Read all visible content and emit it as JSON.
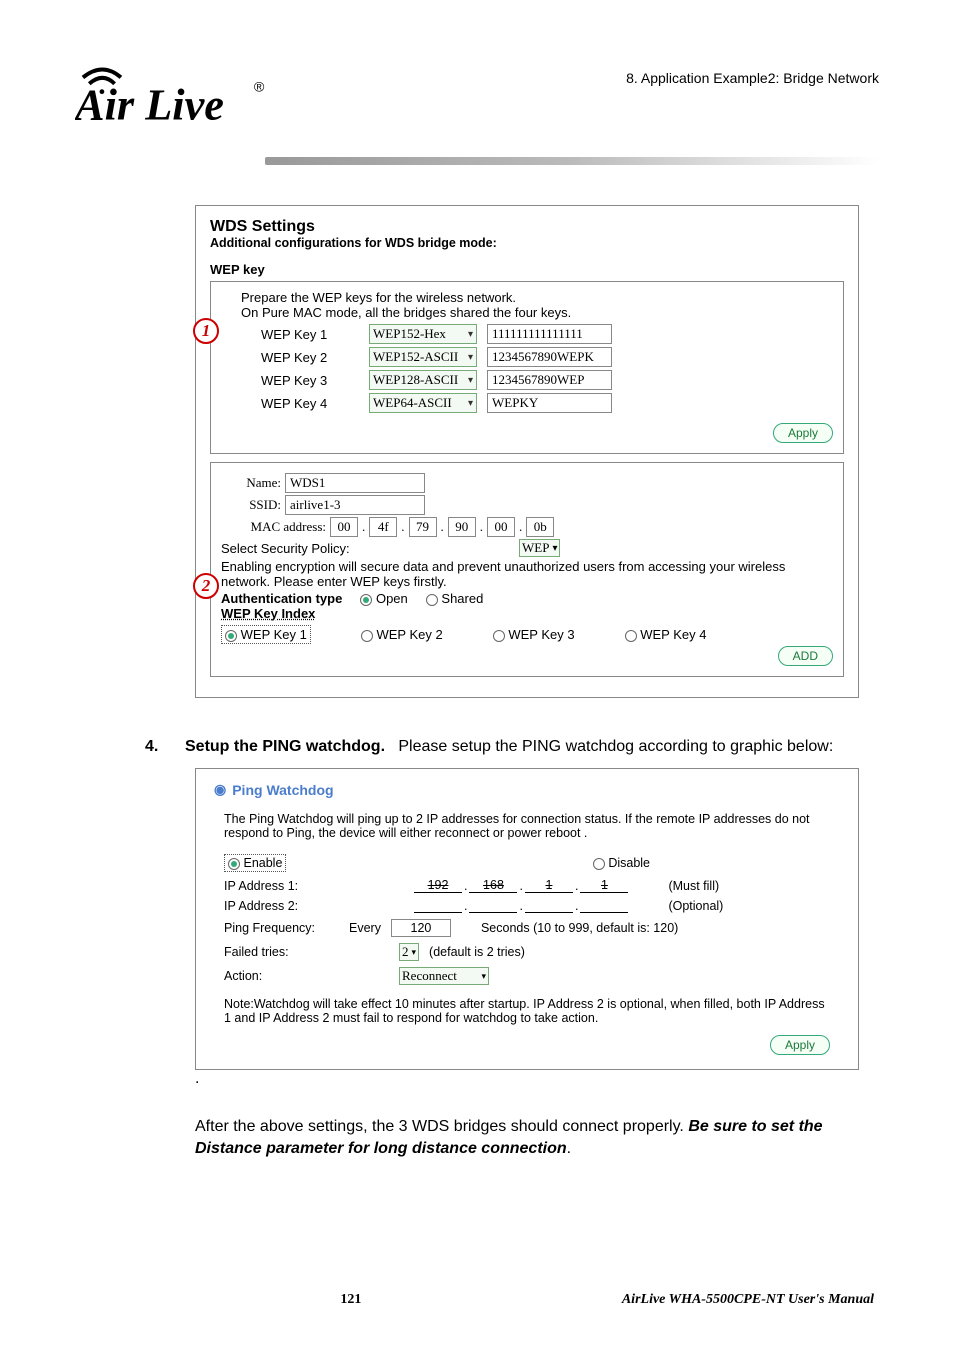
{
  "chapter": "8.  Application  Example2:  Bridge  Network",
  "wds": {
    "title": "WDS Settings",
    "subtitle": "Additional configurations for WDS bridge mode:",
    "wep_heading": "WEP key",
    "intro1": "Prepare the WEP keys for the wireless network.",
    "intro2": "On Pure MAC mode, all the bridges shared the four keys.",
    "keys": [
      {
        "label": "WEP Key 1",
        "type": "WEP152-Hex",
        "value": "111111111111111"
      },
      {
        "label": "WEP Key 2",
        "type": "WEP152-ASCII",
        "value": "1234567890WEPK"
      },
      {
        "label": "WEP Key 3",
        "type": "WEP128-ASCII",
        "value": "1234567890WEP"
      },
      {
        "label": "WEP Key 4",
        "type": "WEP64-ASCII",
        "value": "WEPKY"
      }
    ],
    "apply": "Apply",
    "name_label": "Name:",
    "name_value": "WDS1",
    "ssid_label": "SSID:",
    "ssid_value": "airlive1-3",
    "mac_label": "MAC address:",
    "mac": [
      "00",
      "4f",
      "79",
      "90",
      "00",
      "0b"
    ],
    "security_label": "Select Security Policy:",
    "security_value": "WEP",
    "enc_note": "Enabling encryption will secure data and prevent unauthorized users from accessing your wireless network. Please enter WEP keys firstly.",
    "auth_label": "Authentication type",
    "auth_open": "Open",
    "auth_shared": "Shared",
    "keyindex_label": "WEP Key Index",
    "k1": "WEP Key 1",
    "k2": "WEP Key 2",
    "k3": "WEP Key 3",
    "k4": "WEP Key 4",
    "add": "ADD"
  },
  "step4": {
    "num": "4.",
    "bold": "Setup the PING watchdog.",
    "rest": "Please setup the PING watchdog according to graphic below:"
  },
  "ping": {
    "title": "Ping Watchdog",
    "desc": "The Ping Watchdog will ping up to 2 IP addresses for connection status. If the remote IP addresses do not respond to Ping, the device will either reconnect or power reboot .",
    "enable": "Enable",
    "disable": "Disable",
    "ip1_label": "IP Address 1:",
    "ip1": [
      "192",
      "168",
      "1",
      "1"
    ],
    "ip1_note": "(Must fill)",
    "ip2_label": "IP Address 2:",
    "ip2_note": "(Optional)",
    "freq_label": "Ping Frequency:",
    "freq_every": "Every",
    "freq_val": "120",
    "freq_note": "Seconds (10 to 999, default is: 120)",
    "fail_label": "Failed tries:",
    "fail_val": "2",
    "fail_note": "(default is 2 tries)",
    "action_label": "Action:",
    "action_val": "Reconnect",
    "note": "Note:Watchdog will take effect 10 minutes after startup. IP Address 2 is optional, when filled, both IP Address 1 and IP Address 2 must fail to respond for watchdog to take action.",
    "apply": "Apply"
  },
  "after": {
    "t1": "After the above settings, the 3 WDS bridges should connect properly.   ",
    "t2": "Be sure to set the Distance parameter for long distance connection",
    "t3": "."
  },
  "footer": {
    "page": "121",
    "manual": "AirLive  WHA-5500CPE-NT  User's  Manual"
  }
}
